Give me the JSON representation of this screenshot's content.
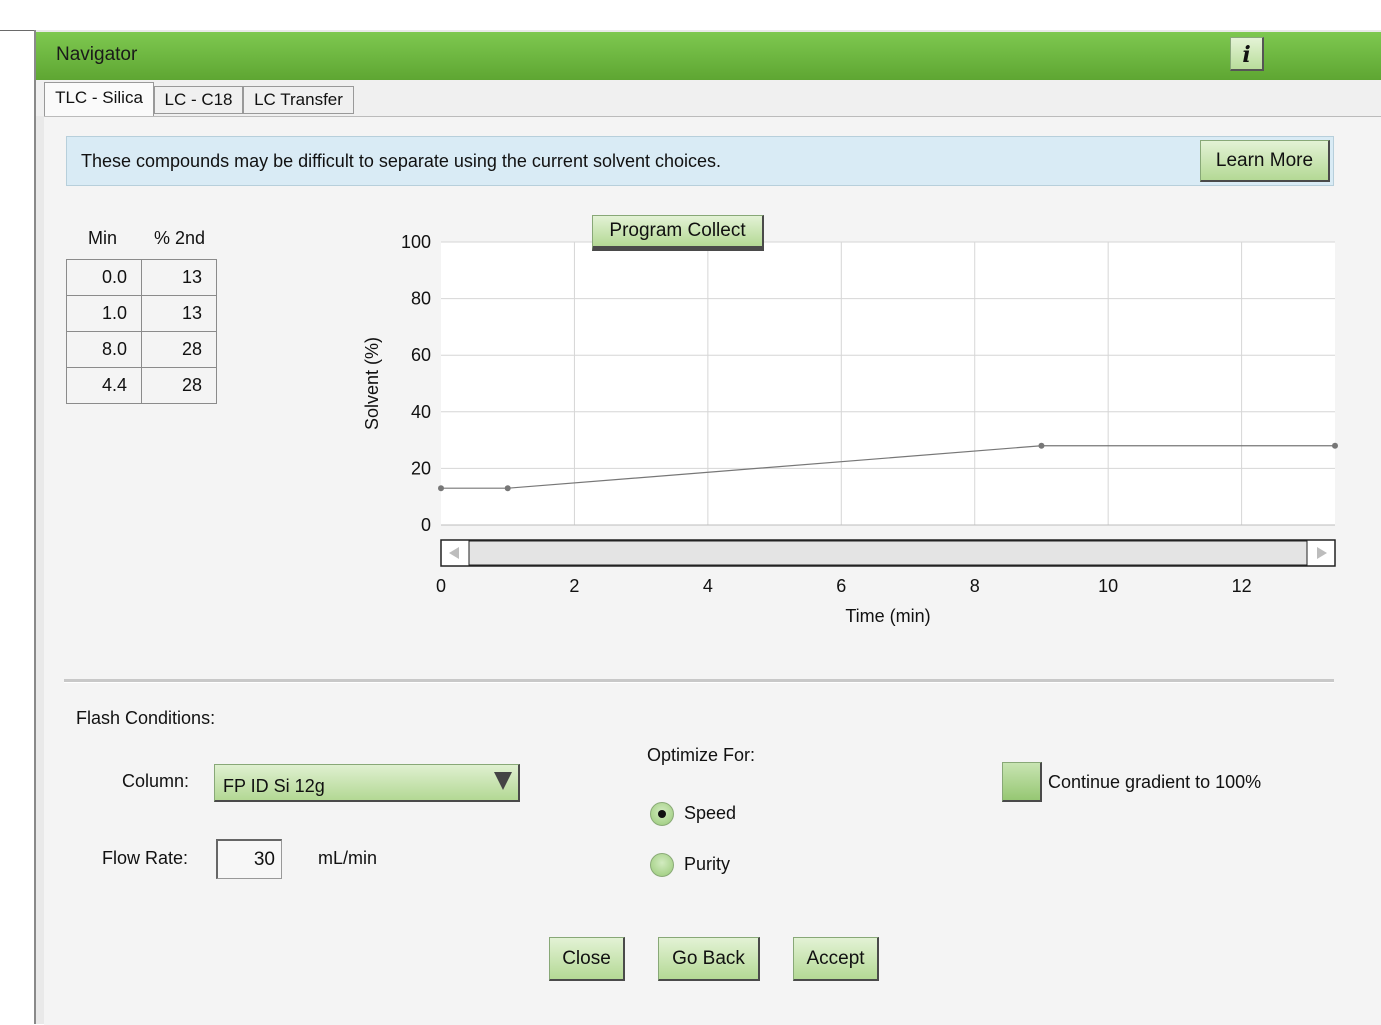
{
  "window": {
    "title": "Navigator",
    "info_label": "i"
  },
  "tabs": [
    {
      "label": "TLC - Silica",
      "active": true
    },
    {
      "label": "LC - C18",
      "active": false
    },
    {
      "label": "LC Transfer",
      "active": false
    }
  ],
  "banner": {
    "message": "These compounds may be difficult to separate using the current solvent choices.",
    "learn_more_label": "Learn More"
  },
  "gradient_table": {
    "headers": [
      "Min",
      "% 2nd"
    ],
    "rows": [
      [
        "0.0",
        "13"
      ],
      [
        "1.0",
        "13"
      ],
      [
        "8.0",
        "28"
      ],
      [
        "4.4",
        "28"
      ]
    ]
  },
  "program_collect_label": "Program Collect",
  "chart_data": {
    "type": "line",
    "xlabel": "Time (min)",
    "ylabel": "Solvent (%)",
    "xlim": [
      0,
      13.4
    ],
    "ylim": [
      0,
      100
    ],
    "x_ticks": [
      0,
      2,
      4,
      6,
      8,
      10,
      12
    ],
    "y_ticks": [
      0,
      20,
      40,
      60,
      80,
      100
    ],
    "grid": true,
    "series": [
      {
        "points": [
          [
            0,
            13
          ],
          [
            1,
            13
          ],
          [
            9,
            28
          ],
          [
            13.4,
            28
          ]
        ]
      }
    ]
  },
  "flash_conditions": {
    "heading": "Flash Conditions:",
    "column_label": "Column:",
    "column_value": "FP ID Si 12g",
    "flow_rate_label": "Flow Rate:",
    "flow_rate_value": "30",
    "flow_rate_unit": "mL/min"
  },
  "optimize": {
    "heading": "Optimize For:",
    "options": [
      {
        "label": "Speed",
        "selected": true
      },
      {
        "label": "Purity",
        "selected": false
      }
    ]
  },
  "continue_gradient_label": "Continue gradient to 100%",
  "buttons": {
    "close": "Close",
    "go_back": "Go Back",
    "accept": "Accept"
  },
  "colors": {
    "title_bar": "#6bb63f",
    "button_green": "#c3e3a8",
    "banner_blue": "#d9ebf5",
    "plot_line": "#777777"
  }
}
